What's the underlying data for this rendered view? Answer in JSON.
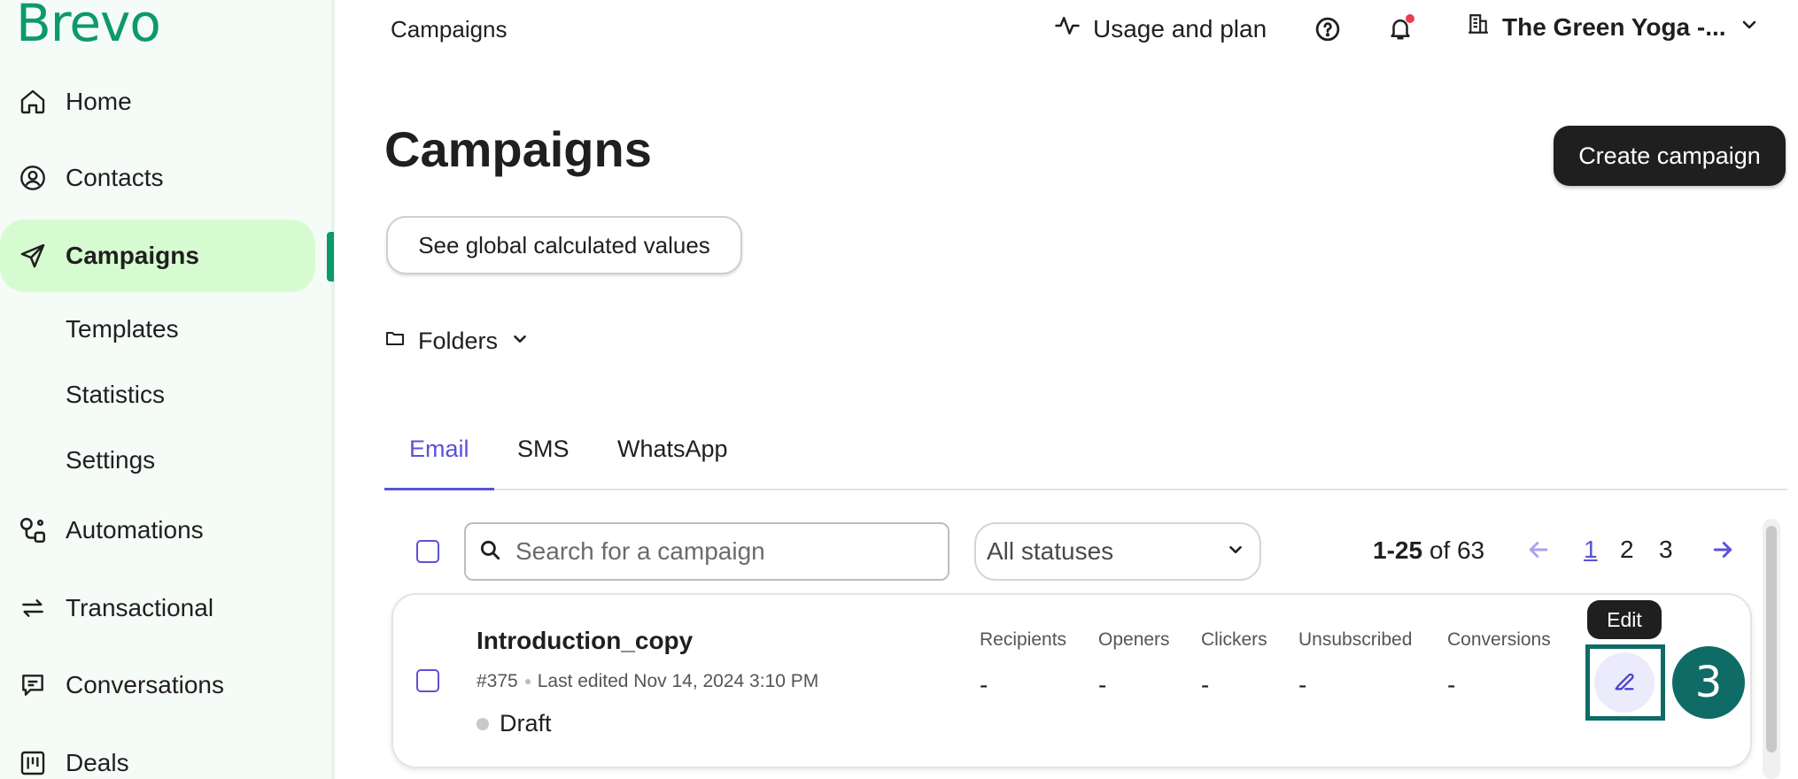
{
  "brand": {
    "logo_text": "Brevo",
    "accent_color": "#0b996e"
  },
  "sidebar": {
    "items": [
      {
        "label": "Home",
        "icon": "home-icon"
      },
      {
        "label": "Contacts",
        "icon": "contacts-icon"
      },
      {
        "label": "Campaigns",
        "icon": "send-icon",
        "active": true
      },
      {
        "label": "Automations",
        "icon": "automations-icon"
      },
      {
        "label": "Transactional",
        "icon": "transactional-icon"
      },
      {
        "label": "Conversations",
        "icon": "conversations-icon"
      },
      {
        "label": "Deals",
        "icon": "deals-icon"
      }
    ],
    "sub_items": [
      {
        "label": "Templates"
      },
      {
        "label": "Statistics"
      },
      {
        "label": "Settings"
      }
    ]
  },
  "topbar": {
    "breadcrumb": "Campaigns",
    "usage_label": "Usage and plan",
    "account_name": "The Green Yoga -..."
  },
  "main": {
    "title": "Campaigns",
    "create_button": "Create campaign",
    "global_values_button": "See global calculated values",
    "folders_label": "Folders",
    "tabs": [
      {
        "label": "Email",
        "active": true
      },
      {
        "label": "SMS"
      },
      {
        "label": "WhatsApp"
      }
    ],
    "search": {
      "placeholder": "Search for a campaign",
      "value": ""
    },
    "status_filter": {
      "selected": "All statuses"
    },
    "pagination": {
      "range": "1-25",
      "of_label": "of 63",
      "pages": [
        "1",
        "2",
        "3"
      ],
      "current_page": "1"
    }
  },
  "campaigns": [
    {
      "name": "Introduction_copy",
      "id": "#375",
      "last_edited": "Last edited Nov 14, 2024 3:10 PM",
      "status": "Draft",
      "metrics": [
        {
          "label": "Recipients",
          "value": "-"
        },
        {
          "label": "Openers",
          "value": "-"
        },
        {
          "label": "Clickers",
          "value": "-"
        },
        {
          "label": "Unsubscribed",
          "value": "-"
        },
        {
          "label": "Conversions",
          "value": "-"
        }
      ]
    }
  ],
  "tooltip": {
    "edit": "Edit"
  },
  "annotation": {
    "step_number": "3"
  }
}
